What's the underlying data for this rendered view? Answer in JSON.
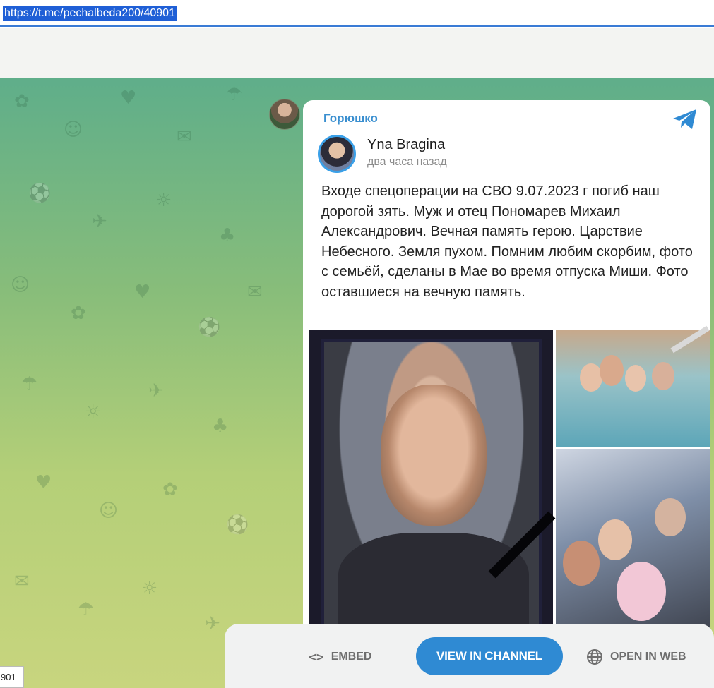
{
  "address_bar": {
    "url": "https://t.me/pechalbeda200/40901"
  },
  "channel": {
    "name": "Горюшко"
  },
  "post": {
    "author": "Yna Bragina",
    "time": "два часа назад",
    "text": "Входе спецоперации на СВО 9.07.2023 г погиб наш дорогой зять. Муж и отец Пономарев Михаил Александрович. Вечная память герою. Царствие Небесного. Земля пухом. Помним любим скорбим, фото с семьёй, сделаны в Мае во время отпуска Миши. Фото оставшиеся на вечную память."
  },
  "actions": {
    "embed_icon": "<>",
    "embed_label": "EMBED",
    "view_label": "VIEW IN CHANNEL",
    "web_label": "OPEN IN WEB"
  },
  "status_tip": "901",
  "colors": {
    "accent": "#2f8ad3",
    "channel_name": "#3a8fd0",
    "url_highlight": "#1f5fd6"
  },
  "icons": [
    "telegram-logo-icon",
    "code-icon",
    "globe-icon"
  ]
}
